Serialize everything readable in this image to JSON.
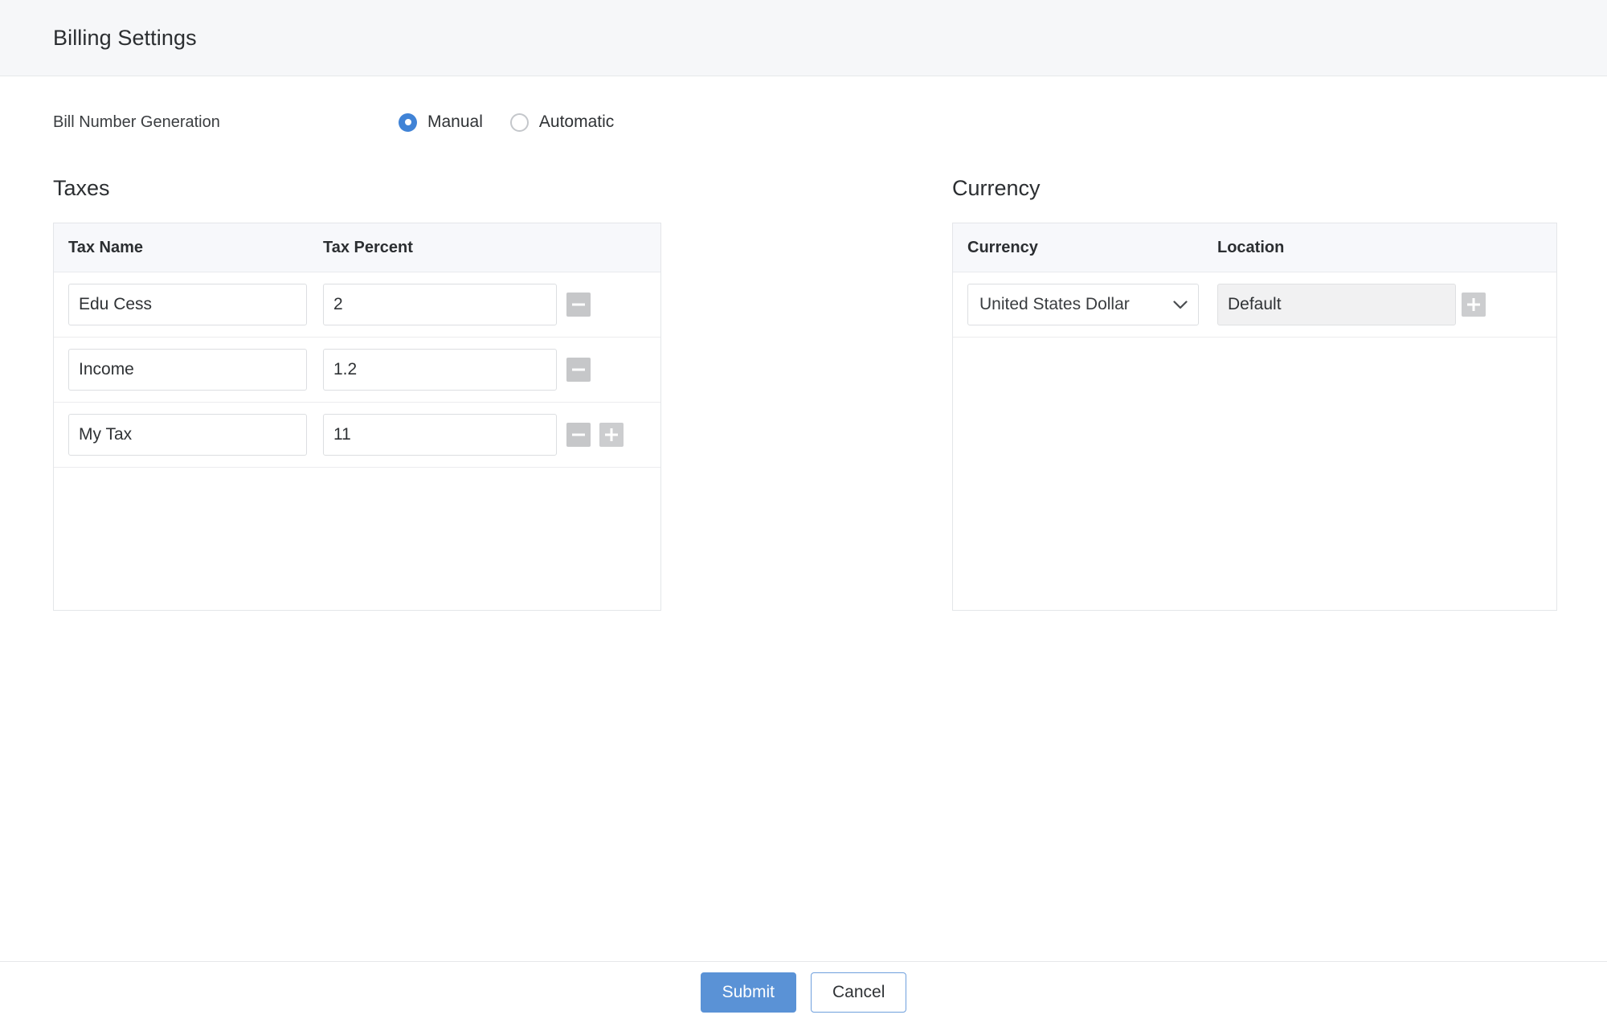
{
  "header": {
    "title": "Billing Settings"
  },
  "bill_number": {
    "label": "Bill Number Generation",
    "options": [
      {
        "label": "Manual",
        "selected": true
      },
      {
        "label": "Automatic",
        "selected": false
      }
    ]
  },
  "taxes": {
    "section_title": "Taxes",
    "columns": [
      "Tax Name",
      "Tax Percent"
    ],
    "rows": [
      {
        "name": "Edu Cess",
        "percent": "2",
        "remove": "−",
        "add": null
      },
      {
        "name": "Income",
        "percent": "1.2",
        "remove": "−",
        "add": null
      },
      {
        "name": "My Tax",
        "percent": "11",
        "remove": "−",
        "add": "+"
      }
    ]
  },
  "currency": {
    "section_title": "Currency",
    "columns": [
      "Currency",
      "Location"
    ],
    "rows": [
      {
        "currency": "United States Dollar",
        "location": "Default",
        "add": "+"
      }
    ]
  },
  "footer": {
    "submit_label": "Submit",
    "cancel_label": "Cancel"
  },
  "colors": {
    "accent": "#4083d6",
    "primary_button": "#5a92d6",
    "header_bg": "#f6f7f9",
    "table_header_bg": "#f7f8fb",
    "icon_gray": "#c6c7c9"
  }
}
